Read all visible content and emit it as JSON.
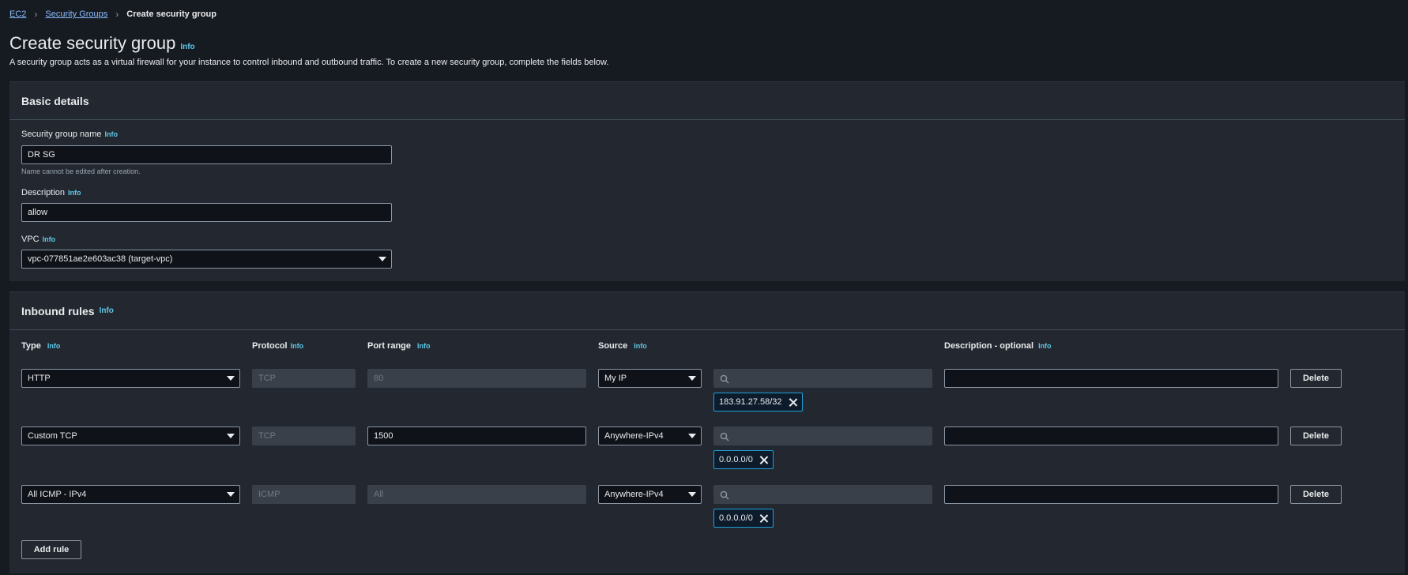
{
  "breadcrumb": {
    "root": "EC2",
    "parent": "Security Groups",
    "current": "Create security group"
  },
  "page": {
    "title": "Create security group",
    "info": "Info",
    "description": "A security group acts as a virtual firewall for your instance to control inbound and outbound traffic. To create a new security group, complete the fields below."
  },
  "basic": {
    "title": "Basic details",
    "name_label": "Security group name",
    "name_value": "DR SG",
    "name_hint": "Name cannot be edited after creation.",
    "desc_label": "Description",
    "desc_value": "allow",
    "vpc_label": "VPC",
    "vpc_value": "vpc-077851ae2e603ac38 (target-vpc)"
  },
  "inbound": {
    "title": "Inbound rules",
    "columns": {
      "type": "Type",
      "protocol": "Protocol",
      "port": "Port range",
      "source": "Source",
      "description": "Description - optional"
    },
    "rules": [
      {
        "type": "HTTP",
        "protocol": "TCP",
        "port": "80",
        "port_editable": false,
        "source": "My IP",
        "cidr": "183.91.27.58/32",
        "description": "",
        "delete": "Delete"
      },
      {
        "type": "Custom TCP",
        "protocol": "TCP",
        "port": "1500",
        "port_editable": true,
        "source": "Anywhere-IPv4",
        "cidr": "0.0.0.0/0",
        "description": "",
        "delete": "Delete"
      },
      {
        "type": "All ICMP - IPv4",
        "protocol": "ICMP",
        "port": "All",
        "port_editable": false,
        "source": "Anywhere-IPv4",
        "cidr": "0.0.0.0/0",
        "description": "",
        "delete": "Delete"
      }
    ],
    "add_rule": "Add rule"
  },
  "icons": {
    "separator": "chevron-right-icon",
    "dropdown": "caret-down-icon",
    "search": "search-icon",
    "remove": "close-icon"
  },
  "colors": {
    "background": "#161a21",
    "panel": "#232830",
    "link": "#89bdff",
    "info": "#5ec8e6",
    "token_border": "#1ea1d8"
  }
}
